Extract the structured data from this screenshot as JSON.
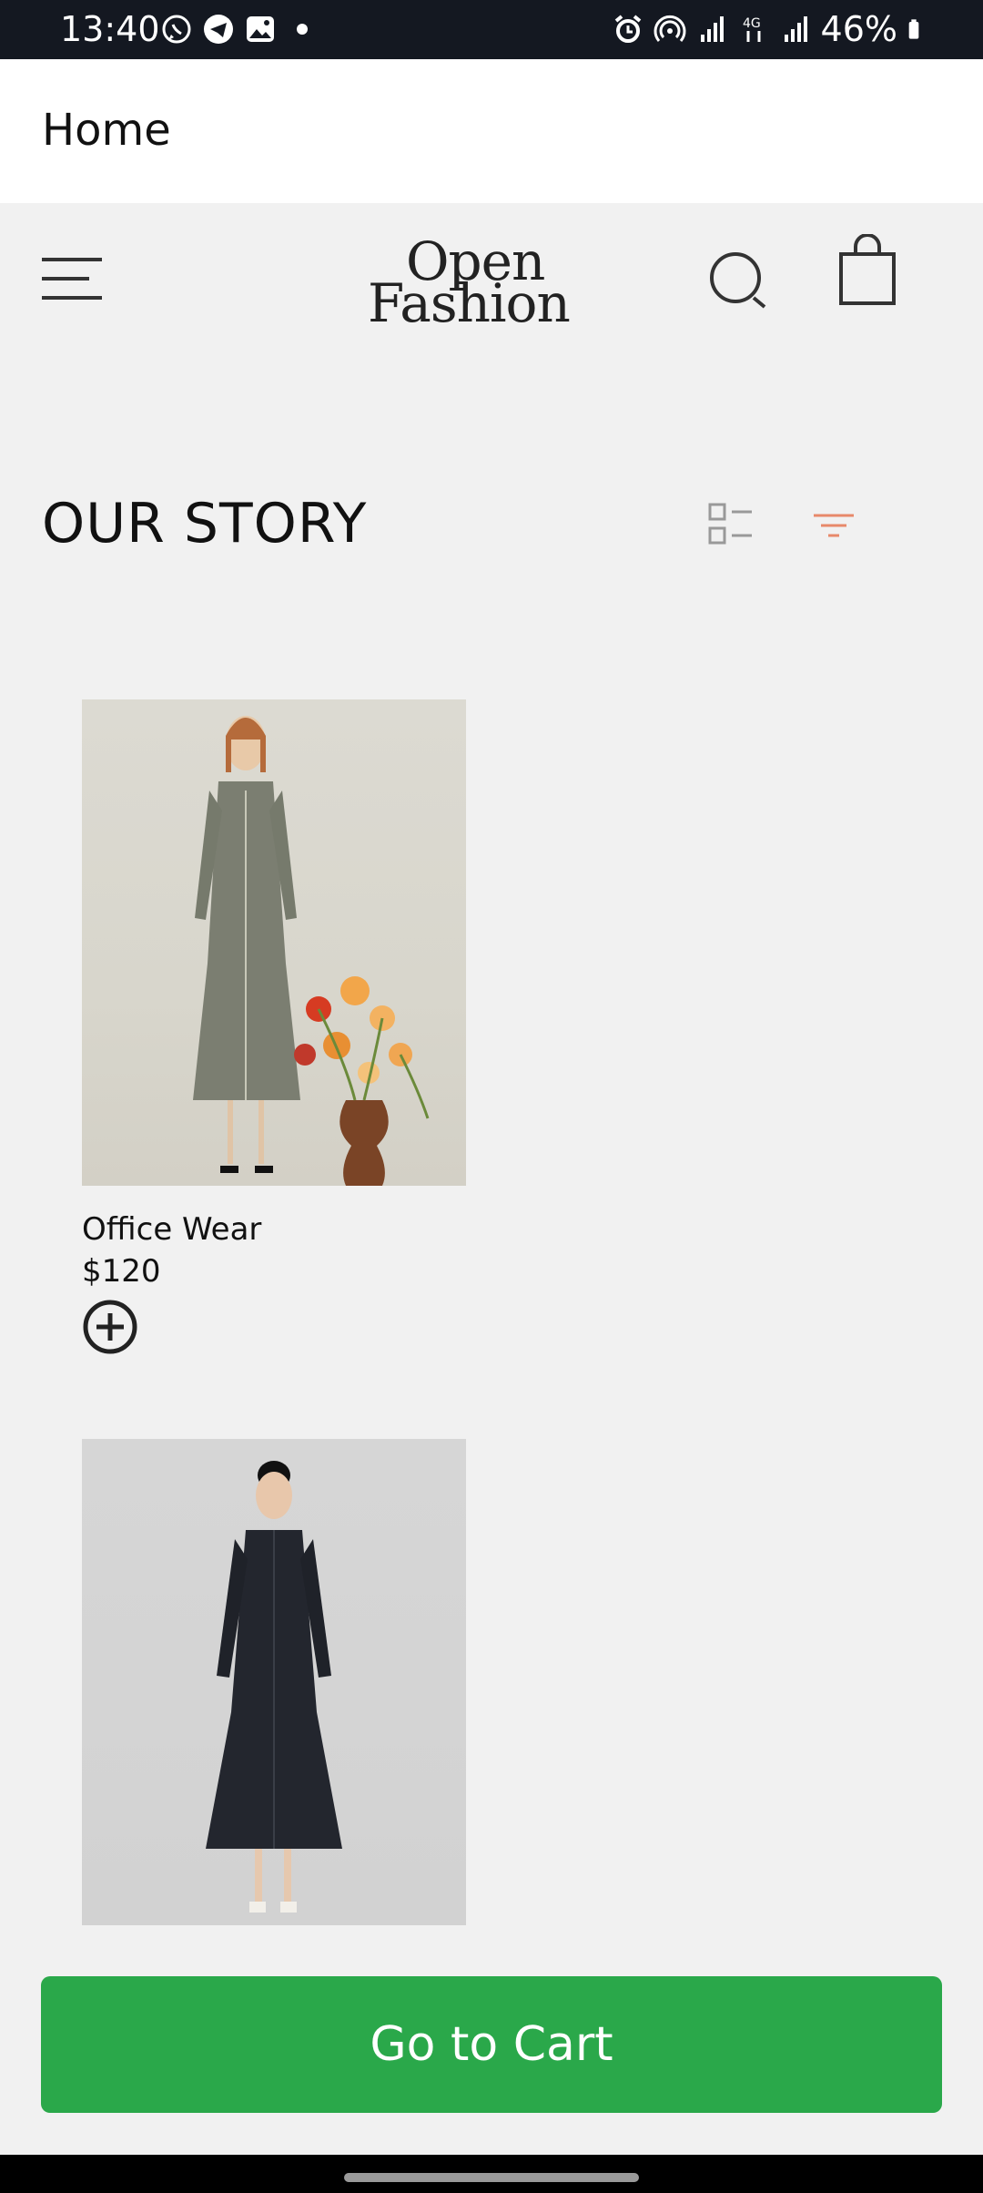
{
  "status_bar": {
    "time": "13:40",
    "battery": "46%",
    "left_icons": [
      "whatsapp-icon",
      "telegram-icon",
      "gallery-icon",
      "dot-icon"
    ],
    "right_icons": [
      "alarm-icon",
      "hotspot-icon",
      "signal-icon",
      "network-4g-icon",
      "signal-icon",
      "battery-icon"
    ]
  },
  "appbar": {
    "title": "Home"
  },
  "header": {
    "logo_line1": "Open",
    "logo_line2": "Fashion"
  },
  "section": {
    "title": "OUR STORY"
  },
  "products": [
    {
      "name": "Office Wear",
      "price": "$120"
    },
    {
      "name": "",
      "price": ""
    }
  ],
  "cart": {
    "label": "Go to Cart"
  },
  "colors": {
    "accent_green": "#2aa84a",
    "filter_orange": "#e8896a",
    "status_bar": "#141821"
  }
}
